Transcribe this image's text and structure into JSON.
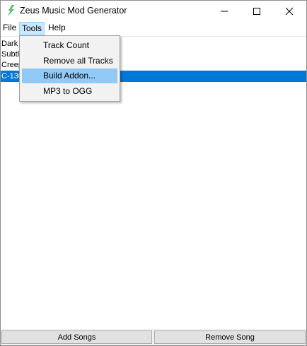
{
  "window": {
    "title": "Zeus Music Mod Generator",
    "icon": "zeus-lightning-icon"
  },
  "menubar": {
    "items": [
      {
        "label": "File"
      },
      {
        "label": "Tools"
      },
      {
        "label": "Help"
      }
    ]
  },
  "tools_menu": {
    "items": [
      {
        "label": "Track Count"
      },
      {
        "label": "Remove all Tracks"
      },
      {
        "label": "Build Addon..."
      },
      {
        "label": "MP3 to OGG"
      }
    ],
    "highlighted": "Build Addon..."
  },
  "track_list": {
    "items": [
      {
        "label": "Dark"
      },
      {
        "label": "Subtle"
      },
      {
        "label": "Creep"
      },
      {
        "label": "C-130"
      }
    ],
    "selected": "C-130"
  },
  "bottom": {
    "add_label": "Add Songs",
    "remove_label": "Remove Song"
  },
  "colors": {
    "selection": "#0078d7",
    "menu_hover": "#91c9f7",
    "menu_active": "#cce8ff",
    "icon_green": "#3aa655"
  }
}
